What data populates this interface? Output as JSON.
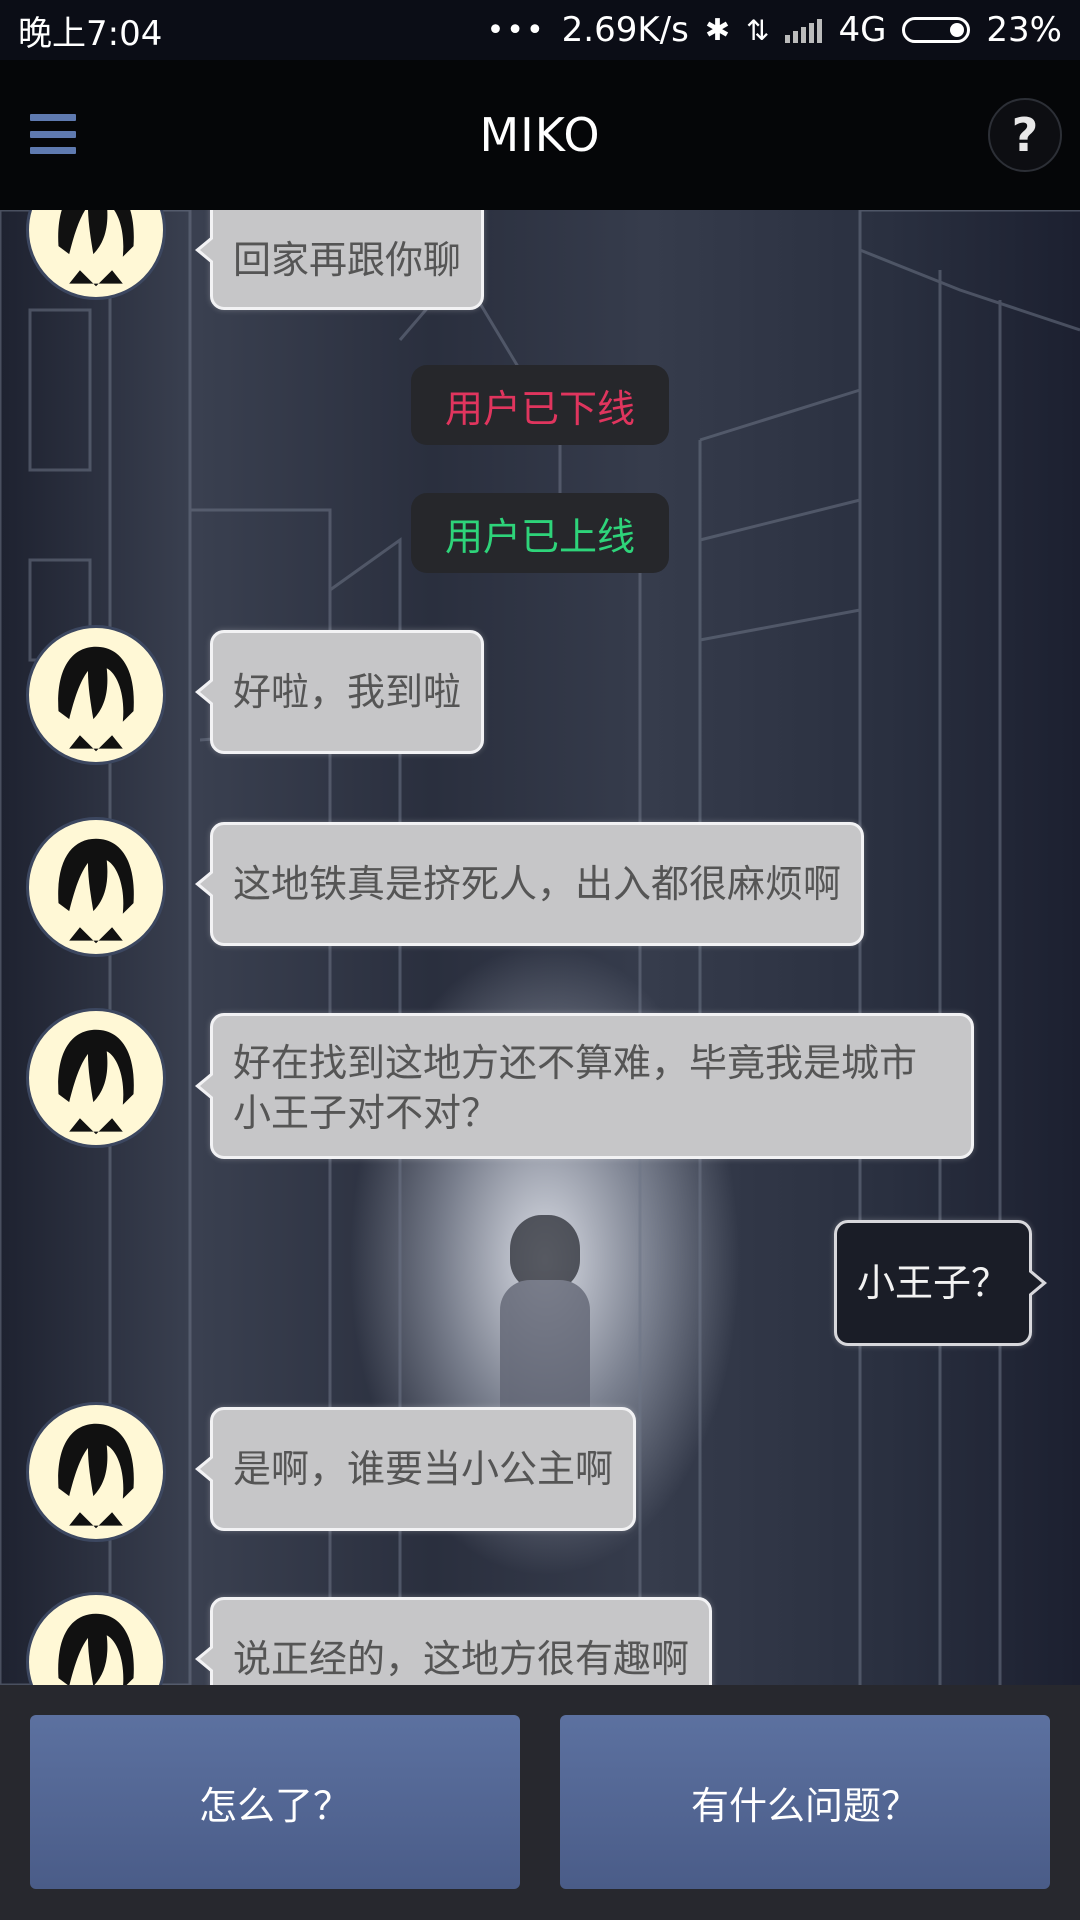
{
  "status_bar": {
    "time": "晚上7:04",
    "dots": "•••",
    "speed": "2.69K/s",
    "bluetooth_icon": "bluetooth-icon",
    "network": "4G",
    "battery": "23%"
  },
  "header": {
    "title": "MIKO",
    "menu_icon": "hamburger-menu-icon",
    "help_label": "?"
  },
  "messages": [
    {
      "type": "left",
      "text": "回家再跟你聊"
    },
    {
      "type": "system",
      "text": "用户已下线",
      "color": "#e0355e"
    },
    {
      "type": "system",
      "text": "用户已上线",
      "color": "#2ed47a"
    },
    {
      "type": "left",
      "text": "好啦，我到啦"
    },
    {
      "type": "left",
      "text": "这地铁真是挤死人，出入都很麻烦啊"
    },
    {
      "type": "left",
      "text": "好在找到这地方还不算难，毕竟我是城市小王子对不对？"
    },
    {
      "type": "right",
      "text": "小王子？"
    },
    {
      "type": "left",
      "text": "是啊，谁要当小公主啊"
    },
    {
      "type": "left",
      "text": "说正经的，这地方很有趣啊"
    }
  ],
  "choices": [
    {
      "label": "怎么了？"
    },
    {
      "label": "有什么问题？"
    }
  ],
  "colors": {
    "choice_button": "#5a6e9c",
    "bubble_left": "#c6c6c8",
    "bubble_right": "#1a1d27",
    "offline": "#e0355e",
    "online": "#2ed47a"
  }
}
